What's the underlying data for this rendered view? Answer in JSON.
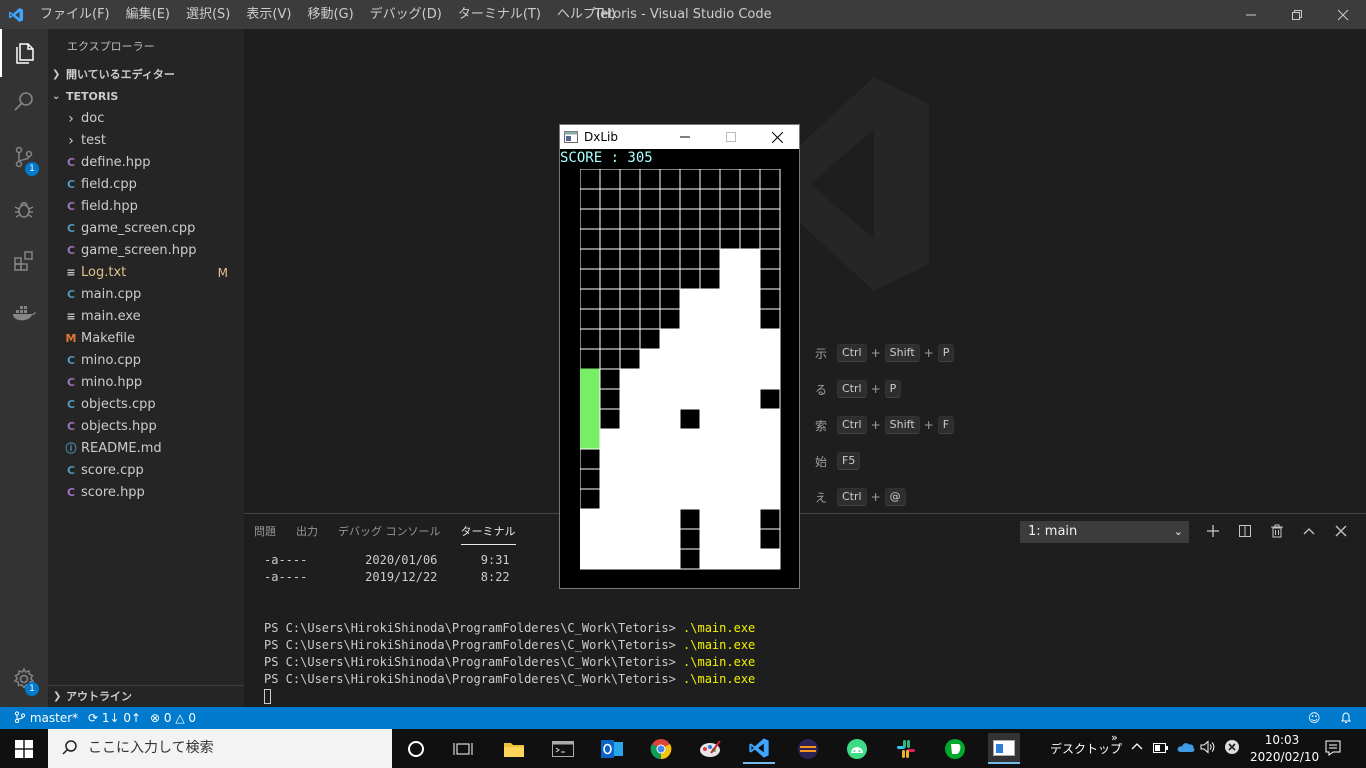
{
  "titlebar": {
    "menu": [
      "ファイル(F)",
      "編集(E)",
      "選択(S)",
      "表示(V)",
      "移動(G)",
      "デバッグ(D)",
      "ターミナル(T)",
      "ヘルプ(H)"
    ],
    "title": "Tetoris - Visual Studio Code"
  },
  "activitybar": {
    "scm_badge": "1",
    "settings_badge": "1"
  },
  "sidebar": {
    "title": "エクスプローラー",
    "open_editors": "開いているエディター",
    "project": "TETORIS",
    "outline": "アウトライン",
    "files": [
      {
        "name": "doc",
        "type": "folder"
      },
      {
        "name": "test",
        "type": "folder"
      },
      {
        "name": "define.hpp",
        "type": "hpp"
      },
      {
        "name": "field.cpp",
        "type": "cpp"
      },
      {
        "name": "field.hpp",
        "type": "hpp"
      },
      {
        "name": "game_screen.cpp",
        "type": "cpp"
      },
      {
        "name": "game_screen.hpp",
        "type": "hpp"
      },
      {
        "name": "Log.txt",
        "type": "txt",
        "badge": "M"
      },
      {
        "name": "main.cpp",
        "type": "cpp"
      },
      {
        "name": "main.exe",
        "type": "txt"
      },
      {
        "name": "Makefile",
        "type": "mk"
      },
      {
        "name": "mino.cpp",
        "type": "cpp"
      },
      {
        "name": "mino.hpp",
        "type": "hpp"
      },
      {
        "name": "objects.cpp",
        "type": "cpp"
      },
      {
        "name": "objects.hpp",
        "type": "hpp"
      },
      {
        "name": "README.md",
        "type": "info"
      },
      {
        "name": "score.cpp",
        "type": "cpp"
      },
      {
        "name": "score.hpp",
        "type": "hpp"
      }
    ]
  },
  "editor": {
    "shortcuts": [
      {
        "label": "示",
        "keys": [
          "Ctrl",
          "Shift",
          "P"
        ]
      },
      {
        "label": "る",
        "keys": [
          "Ctrl",
          "P"
        ]
      },
      {
        "label": "索",
        "keys": [
          "Ctrl",
          "Shift",
          "F"
        ]
      },
      {
        "label": "始",
        "keys": [
          "F5"
        ]
      },
      {
        "label": "え",
        "keys": [
          "Ctrl",
          "@"
        ]
      }
    ]
  },
  "panel": {
    "tabs": [
      "問題",
      "出力",
      "デバッグ コンソール",
      "ターミナル"
    ],
    "active_tab": 3,
    "terminal_select": "1: main",
    "lines": [
      {
        "text": "-a----        2020/01/06      9:31",
        "cmd": ""
      },
      {
        "text": "-a----        2019/12/22      8:22",
        "cmd": ""
      },
      {
        "text": "",
        "cmd": ""
      },
      {
        "text": "",
        "cmd": ""
      },
      {
        "text": "PS C:\\Users\\HirokiShinoda\\ProgramFolderes\\C_Work\\Tetoris> ",
        "cmd": ".\\main.exe"
      },
      {
        "text": "PS C:\\Users\\HirokiShinoda\\ProgramFolderes\\C_Work\\Tetoris> ",
        "cmd": ".\\main.exe"
      },
      {
        "text": "PS C:\\Users\\HirokiShinoda\\ProgramFolderes\\C_Work\\Tetoris> ",
        "cmd": ".\\main.exe"
      },
      {
        "text": "PS C:\\Users\\HirokiShinoda\\ProgramFolderes\\C_Work\\Tetoris> ",
        "cmd": ".\\main.exe"
      }
    ]
  },
  "statusbar": {
    "branch": "master*",
    "sync": "1↓ 0↑",
    "errors": "0",
    "warnings": "0"
  },
  "taskbar": {
    "search_placeholder": "ここに入力して検索",
    "desktop_label": "デスクトップ",
    "time": "10:03",
    "date": "2020/02/10"
  },
  "dxlib": {
    "title": "DxLib",
    "score_text": "SCORE : 305",
    "colors": {
      "empty": "#000000",
      "filled": "#ffffff",
      "active": "#77ee66",
      "score": "#aaffff"
    },
    "board": [
      "0000000000",
      "0000000000",
      "0000000000",
      "0000000000",
      "0000000110",
      "0000000110",
      "0000011110",
      "0000011110",
      "0000111111",
      "0001111111",
      "2011111111",
      "2011111110",
      "2011151111",
      "2111111111",
      "0111111111",
      "0111111111",
      "0111111111",
      "1111151110",
      "1111151110",
      "1111151111"
    ]
  }
}
